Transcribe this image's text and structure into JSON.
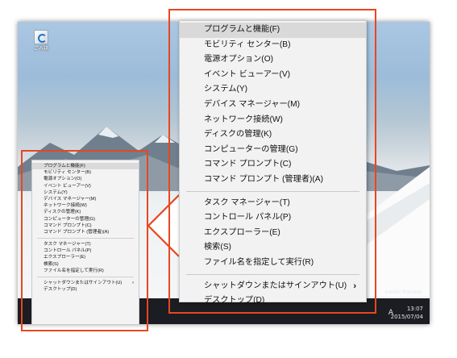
{
  "desktop": {
    "icon_label": "ごみ箱",
    "watermark": "Insider Preview",
    "tray_letter": "A",
    "clock_time": "13:07",
    "clock_date": "2015/07/04"
  },
  "menu": {
    "group1": [
      "プログラムと機能(F)",
      "モビリティ センター(B)",
      "電源オプション(O)",
      "イベント ビューアー(V)",
      "システム(Y)",
      "デバイス マネージャー(M)",
      "ネットワーク接続(W)",
      "ディスクの管理(K)",
      "コンピューターの管理(G)",
      "コマンド プロンプト(C)",
      "コマンド プロンプト (管理者)(A)"
    ],
    "group2": [
      "タスク マネージャー(T)",
      "コントロール パネル(P)",
      "エクスプローラー(E)",
      "検索(S)",
      "ファイル名を指定して実行(R)"
    ],
    "group3": [
      "シャットダウンまたはサインアウト(U)",
      "デスクトップ(D)"
    ],
    "submenu_arrow": "›",
    "highlight_color": "#e8471f"
  }
}
